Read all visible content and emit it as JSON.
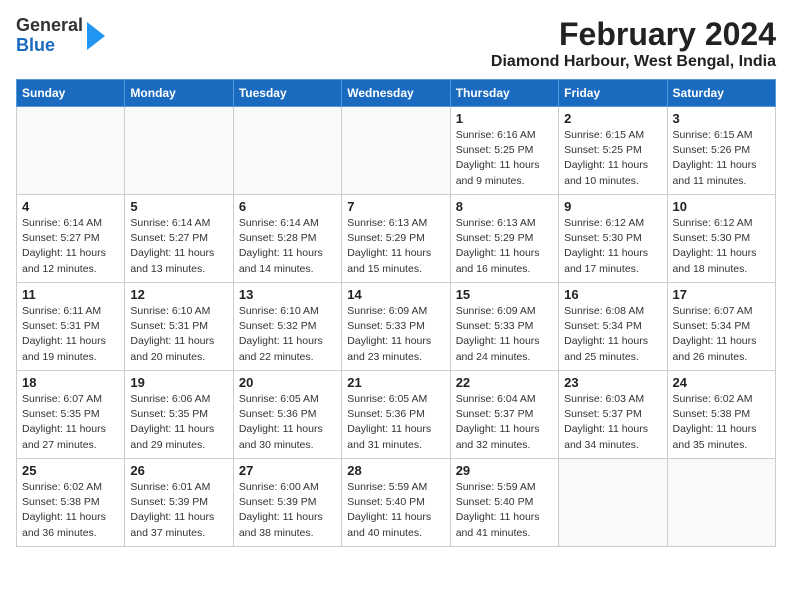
{
  "header": {
    "logo_general": "General",
    "logo_blue": "Blue",
    "title": "February 2024",
    "subtitle": "Diamond Harbour, West Bengal, India"
  },
  "weekdays": [
    "Sunday",
    "Monday",
    "Tuesday",
    "Wednesday",
    "Thursday",
    "Friday",
    "Saturday"
  ],
  "weeks": [
    [
      {
        "day": "",
        "info": ""
      },
      {
        "day": "",
        "info": ""
      },
      {
        "day": "",
        "info": ""
      },
      {
        "day": "",
        "info": ""
      },
      {
        "day": "1",
        "info": "Sunrise: 6:16 AM\nSunset: 5:25 PM\nDaylight: 11 hours\nand 9 minutes."
      },
      {
        "day": "2",
        "info": "Sunrise: 6:15 AM\nSunset: 5:25 PM\nDaylight: 11 hours\nand 10 minutes."
      },
      {
        "day": "3",
        "info": "Sunrise: 6:15 AM\nSunset: 5:26 PM\nDaylight: 11 hours\nand 11 minutes."
      }
    ],
    [
      {
        "day": "4",
        "info": "Sunrise: 6:14 AM\nSunset: 5:27 PM\nDaylight: 11 hours\nand 12 minutes."
      },
      {
        "day": "5",
        "info": "Sunrise: 6:14 AM\nSunset: 5:27 PM\nDaylight: 11 hours\nand 13 minutes."
      },
      {
        "day": "6",
        "info": "Sunrise: 6:14 AM\nSunset: 5:28 PM\nDaylight: 11 hours\nand 14 minutes."
      },
      {
        "day": "7",
        "info": "Sunrise: 6:13 AM\nSunset: 5:29 PM\nDaylight: 11 hours\nand 15 minutes."
      },
      {
        "day": "8",
        "info": "Sunrise: 6:13 AM\nSunset: 5:29 PM\nDaylight: 11 hours\nand 16 minutes."
      },
      {
        "day": "9",
        "info": "Sunrise: 6:12 AM\nSunset: 5:30 PM\nDaylight: 11 hours\nand 17 minutes."
      },
      {
        "day": "10",
        "info": "Sunrise: 6:12 AM\nSunset: 5:30 PM\nDaylight: 11 hours\nand 18 minutes."
      }
    ],
    [
      {
        "day": "11",
        "info": "Sunrise: 6:11 AM\nSunset: 5:31 PM\nDaylight: 11 hours\nand 19 minutes."
      },
      {
        "day": "12",
        "info": "Sunrise: 6:10 AM\nSunset: 5:31 PM\nDaylight: 11 hours\nand 20 minutes."
      },
      {
        "day": "13",
        "info": "Sunrise: 6:10 AM\nSunset: 5:32 PM\nDaylight: 11 hours\nand 22 minutes."
      },
      {
        "day": "14",
        "info": "Sunrise: 6:09 AM\nSunset: 5:33 PM\nDaylight: 11 hours\nand 23 minutes."
      },
      {
        "day": "15",
        "info": "Sunrise: 6:09 AM\nSunset: 5:33 PM\nDaylight: 11 hours\nand 24 minutes."
      },
      {
        "day": "16",
        "info": "Sunrise: 6:08 AM\nSunset: 5:34 PM\nDaylight: 11 hours\nand 25 minutes."
      },
      {
        "day": "17",
        "info": "Sunrise: 6:07 AM\nSunset: 5:34 PM\nDaylight: 11 hours\nand 26 minutes."
      }
    ],
    [
      {
        "day": "18",
        "info": "Sunrise: 6:07 AM\nSunset: 5:35 PM\nDaylight: 11 hours\nand 27 minutes."
      },
      {
        "day": "19",
        "info": "Sunrise: 6:06 AM\nSunset: 5:35 PM\nDaylight: 11 hours\nand 29 minutes."
      },
      {
        "day": "20",
        "info": "Sunrise: 6:05 AM\nSunset: 5:36 PM\nDaylight: 11 hours\nand 30 minutes."
      },
      {
        "day": "21",
        "info": "Sunrise: 6:05 AM\nSunset: 5:36 PM\nDaylight: 11 hours\nand 31 minutes."
      },
      {
        "day": "22",
        "info": "Sunrise: 6:04 AM\nSunset: 5:37 PM\nDaylight: 11 hours\nand 32 minutes."
      },
      {
        "day": "23",
        "info": "Sunrise: 6:03 AM\nSunset: 5:37 PM\nDaylight: 11 hours\nand 34 minutes."
      },
      {
        "day": "24",
        "info": "Sunrise: 6:02 AM\nSunset: 5:38 PM\nDaylight: 11 hours\nand 35 minutes."
      }
    ],
    [
      {
        "day": "25",
        "info": "Sunrise: 6:02 AM\nSunset: 5:38 PM\nDaylight: 11 hours\nand 36 minutes."
      },
      {
        "day": "26",
        "info": "Sunrise: 6:01 AM\nSunset: 5:39 PM\nDaylight: 11 hours\nand 37 minutes."
      },
      {
        "day": "27",
        "info": "Sunrise: 6:00 AM\nSunset: 5:39 PM\nDaylight: 11 hours\nand 38 minutes."
      },
      {
        "day": "28",
        "info": "Sunrise: 5:59 AM\nSunset: 5:40 PM\nDaylight: 11 hours\nand 40 minutes."
      },
      {
        "day": "29",
        "info": "Sunrise: 5:59 AM\nSunset: 5:40 PM\nDaylight: 11 hours\nand 41 minutes."
      },
      {
        "day": "",
        "info": ""
      },
      {
        "day": "",
        "info": ""
      }
    ]
  ]
}
